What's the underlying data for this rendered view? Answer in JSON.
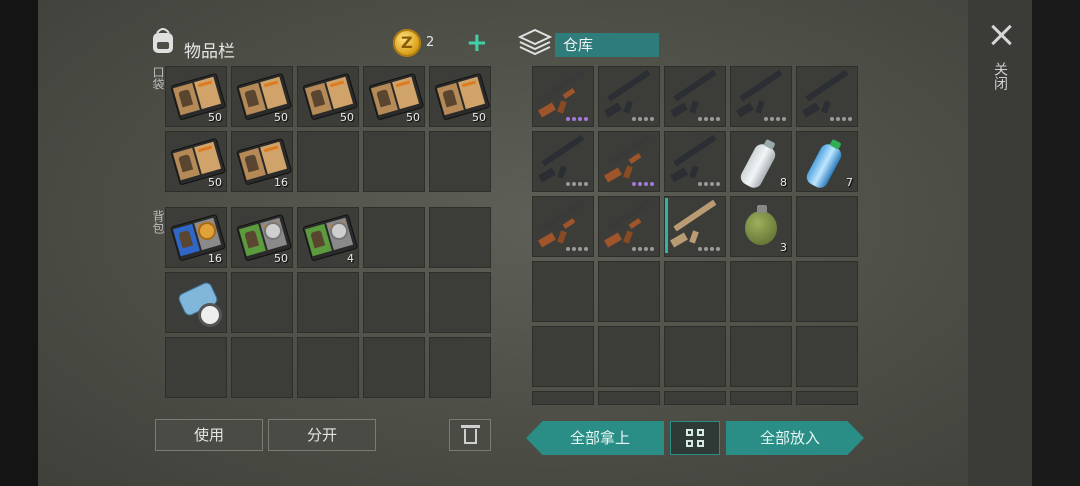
{
  "inventory": {
    "title": "物品栏",
    "coins": "2",
    "plus_label": "+",
    "pocket_label": "口袋",
    "backpack_label": "背包",
    "pocket_slots": [
      {
        "icon": "book-icon",
        "qty": "50"
      },
      {
        "icon": "book-icon",
        "qty": "50"
      },
      {
        "icon": "book-icon",
        "qty": "50"
      },
      {
        "icon": "book-icon",
        "qty": "50"
      },
      {
        "icon": "book-icon",
        "qty": "50"
      },
      {
        "icon": "book-icon",
        "qty": "50"
      },
      {
        "icon": "book-icon",
        "qty": "16"
      },
      {
        "icon": "",
        "qty": ""
      },
      {
        "icon": "",
        "qty": ""
      },
      {
        "icon": "",
        "qty": ""
      }
    ],
    "backpack_slots": [
      {
        "icon": "blue-book-icon",
        "qty": "16"
      },
      {
        "icon": "green-book-icon",
        "qty": "50"
      },
      {
        "icon": "green-book-icon",
        "qty": "4"
      },
      {
        "icon": "",
        "qty": ""
      },
      {
        "icon": "",
        "qty": ""
      },
      {
        "icon": "map-icon",
        "qty": ""
      },
      {
        "icon": "",
        "qty": ""
      },
      {
        "icon": "",
        "qty": ""
      },
      {
        "icon": "",
        "qty": ""
      },
      {
        "icon": "",
        "qty": ""
      },
      {
        "icon": "",
        "qty": ""
      },
      {
        "icon": "",
        "qty": ""
      },
      {
        "icon": "",
        "qty": ""
      },
      {
        "icon": "",
        "qty": ""
      },
      {
        "icon": "",
        "qty": ""
      }
    ],
    "use_label": "使用",
    "split_label": "分开"
  },
  "warehouse": {
    "title": "仓库",
    "slots": [
      {
        "icon": "ak-rifle-icon",
        "qty": "",
        "dots": "purple"
      },
      {
        "icon": "rifle-icon",
        "qty": "",
        "dots": "grey"
      },
      {
        "icon": "rifle-icon",
        "qty": "",
        "dots": "grey"
      },
      {
        "icon": "rifle-icon",
        "qty": "",
        "dots": "grey"
      },
      {
        "icon": "rifle-icon",
        "qty": "",
        "dots": "grey"
      },
      {
        "icon": "rifle-icon",
        "qty": "",
        "dots": "grey"
      },
      {
        "icon": "ak-rifle-icon",
        "qty": "",
        "dots": "purple"
      },
      {
        "icon": "rifle-icon",
        "qty": "",
        "dots": "grey"
      },
      {
        "icon": "water-bottle-icon",
        "qty": "8",
        "dots": ""
      },
      {
        "icon": "blue-water-bottle-icon",
        "qty": "7",
        "dots": ""
      },
      {
        "icon": "ak-rifle-icon",
        "qty": "",
        "dots": "grey"
      },
      {
        "icon": "ak-rifle-icon",
        "qty": "",
        "dots": "grey"
      },
      {
        "icon": "tan-rifle-icon",
        "qty": "",
        "dots": "grey"
      },
      {
        "icon": "grenade-icon",
        "qty": "3",
        "dots": ""
      },
      {
        "icon": "",
        "qty": "",
        "dots": ""
      }
    ],
    "take_all_label": "全部拿上",
    "put_all_label": "全部放入"
  },
  "close_label": "关闭",
  "colors": {
    "accent": "#2a8e86",
    "coin": "#d9a21e"
  }
}
